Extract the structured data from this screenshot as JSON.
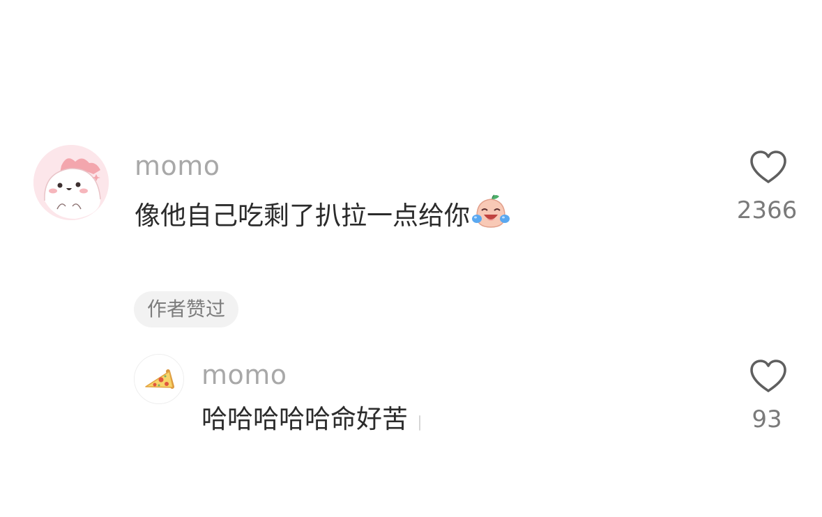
{
  "comments": [
    {
      "username": "momo",
      "text": "像他自己吃剩了扒拉一点给你",
      "emoji_icon": "crying-laughing-peach-icon",
      "likes": "2366",
      "avatar_icon": "pink-dinosaur-avatar-icon"
    }
  ],
  "author_liked_badge": "作者赞过",
  "reply": {
    "username": "momo",
    "text": "哈哈哈哈哈命好苦",
    "likes": "93",
    "avatar_icon": "pizza-slice-avatar-icon"
  },
  "colors": {
    "username": "#a8a8a8",
    "text": "#2b2b2b",
    "count": "#7a7a7a",
    "badge_bg": "#f2f2f2",
    "heart_outline": "#5f5f5f"
  }
}
